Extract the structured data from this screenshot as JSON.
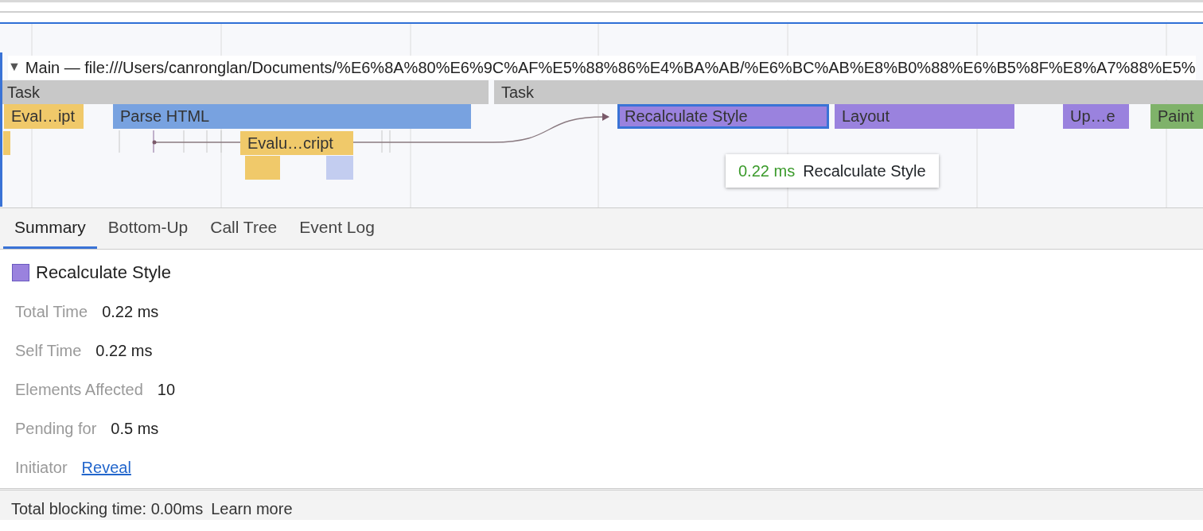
{
  "track": {
    "toggle": "▼",
    "title": "Main — file:///Users/canronglan/Documents/%E6%8A%80%E6%9C%AF%E5%88%86%E4%BA%AB/%E6%BC%AB%E8%B0%88%E6%B5%8F%E8%A7%88%E5%"
  },
  "flame_rows": [
    {
      "bars": [
        {
          "label": "Task",
          "color": "#c8c8c8",
          "selected": false
        },
        {
          "label": "Task",
          "color": "#c8c8c8",
          "selected": false
        }
      ]
    },
    {
      "bars": [
        {
          "label": "Eval…ipt",
          "color": "#f0c96a",
          "selected": false
        },
        {
          "label": "Parse HTML",
          "color": "#78a2e0",
          "selected": false
        },
        {
          "label": "Recalculate Style",
          "color": "#9a82de",
          "selected": true
        },
        {
          "label": "Layout",
          "color": "#9a82de",
          "selected": false
        },
        {
          "label": "Up…e",
          "color": "#9a82de",
          "selected": false
        },
        {
          "label": "Paint",
          "color": "#7fb26a",
          "selected": false
        }
      ]
    },
    {
      "bars": [
        {
          "color": "#f0c96a",
          "selected": false
        },
        {
          "label": "Evalu…cript",
          "color": "#f0c96a",
          "selected": false
        }
      ]
    },
    {
      "bars": [
        {
          "color": "#f0c96a",
          "selected": false
        },
        {
          "color": "#c3cdf0",
          "selected": false
        }
      ]
    }
  ],
  "tooltip": {
    "duration": "0.22 ms",
    "name": "Recalculate Style"
  },
  "tabs": [
    {
      "label": "Summary",
      "selected": true
    },
    {
      "label": "Bottom-Up",
      "selected": false
    },
    {
      "label": "Call Tree",
      "selected": false
    },
    {
      "label": "Event Log",
      "selected": false
    }
  ],
  "summary": {
    "title": "Recalculate Style",
    "color": "#9a82de",
    "rows": [
      {
        "kind": "text",
        "label": "Total Time",
        "value": "0.22 ms"
      },
      {
        "kind": "text",
        "label": "Self Time",
        "value": "0.22 ms"
      },
      {
        "kind": "text",
        "label": "Elements Affected",
        "value": "10"
      },
      {
        "kind": "text",
        "label": "Pending for",
        "value": "0.5 ms"
      },
      {
        "kind": "link",
        "label": "Initiator",
        "value": "Reveal"
      }
    ]
  },
  "status_bar": {
    "text": "Total blocking time: 0.00ms",
    "link": "Learn more"
  }
}
